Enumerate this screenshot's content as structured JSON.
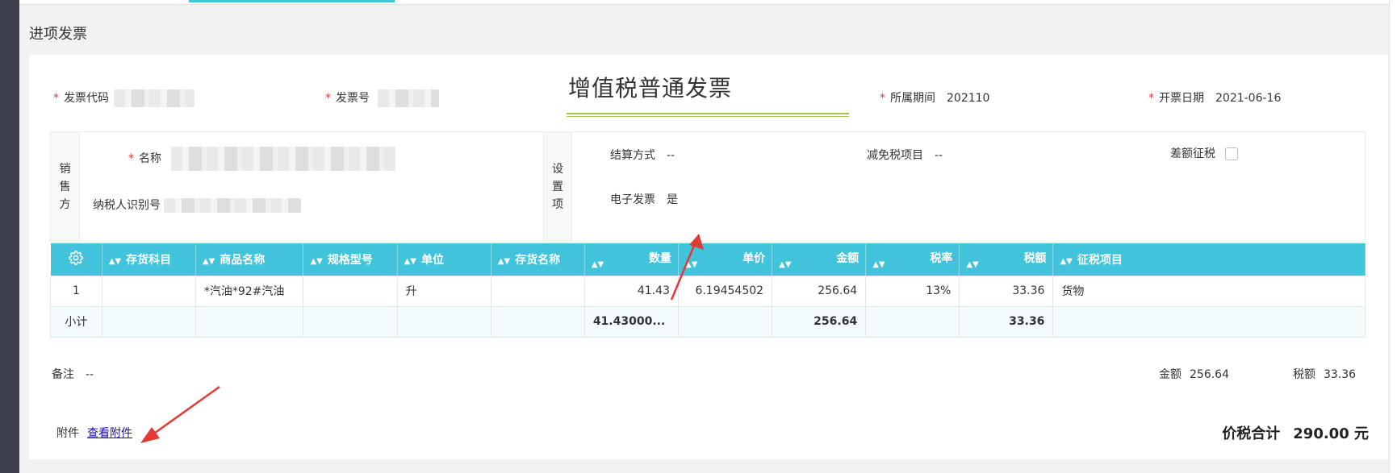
{
  "page_title": "进项发票",
  "invoice_title": "增值税普通发票",
  "header": {
    "code_label": "发票代码",
    "number_label": "发票号",
    "period_label": "所属期间",
    "period_value": "202110",
    "date_label": "开票日期",
    "date_value": "2021-06-16",
    "required_mark": "*"
  },
  "seller": {
    "section_label": [
      "销",
      "售",
      "方"
    ],
    "name_label": "名称",
    "taxid_label": "纳税人识别号"
  },
  "settings": {
    "section_label": [
      "设",
      "置",
      "项"
    ],
    "settlement_label": "结算方式",
    "settlement_value": "--",
    "exemption_label": "减免税项目",
    "exemption_value": "--",
    "diff_tax_label": "差额征税",
    "einvoice_label": "电子发票",
    "einvoice_value": "是"
  },
  "table": {
    "settings_icon": "gear-icon",
    "sort_icon": "sort-icon",
    "columns": [
      "存货科目",
      "商品名称",
      "规格型号",
      "单位",
      "存货名称",
      "数量",
      "单价",
      "金额",
      "税率",
      "税额",
      "征税项目"
    ],
    "rows": [
      [
        "1",
        "",
        "*汽油*92#汽油",
        "",
        "升",
        "",
        "41.43",
        "6.19454502",
        "256.64",
        "13%",
        "33.36",
        "货物"
      ]
    ],
    "subtotal": [
      "小计",
      "",
      "",
      "",
      "",
      "",
      "41.43000...",
      "",
      "256.64",
      "",
      "33.36",
      ""
    ]
  },
  "footer": {
    "remark_label": "备注",
    "remark_value": "--",
    "amount_label": "金额",
    "amount_value": "256.64",
    "tax_label": "税额",
    "tax_value": "33.36",
    "attachment_label": "附件",
    "attachment_link": "查看附件",
    "total_label": "价税合计",
    "total_value": "290.00 元"
  },
  "colors": {
    "accent": "#41c3db",
    "required": "#e5383b",
    "title_underline": "#a0c84a",
    "annotation_arrow": "#e53935"
  }
}
